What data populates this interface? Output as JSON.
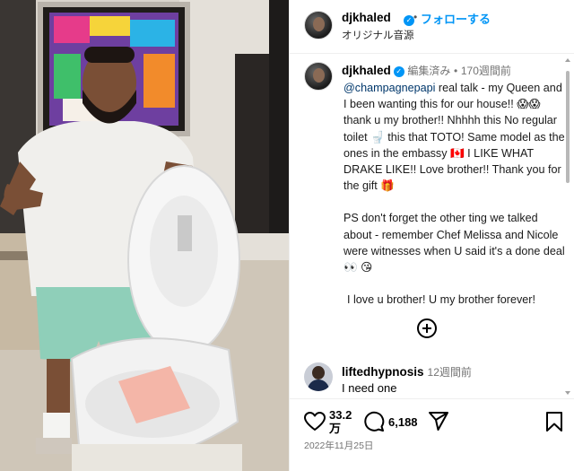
{
  "post": {
    "username": "djkhaled",
    "follow_label": "フォローする",
    "audio": "オリジナル音源",
    "separator": "•"
  },
  "caption": {
    "username": "djkhaled",
    "edited": "編集済み",
    "time": "170週間前",
    "mention": "@champagnepapi",
    "line1_rest": " real talk - my Queen and I been wanting this for our house!! 😱😱 thank u my brother!! Nhhhh this No regular toilet 🚽 this that TOTO! Same model as the ones in the embassy 🇨🇦 I LIKE WHAT DRAKE LIKE!! Love brother!! Thank you for the gift 🎁",
    "para2": "PS don't forget the other ting we talked about - remember Chef Melissa and Nicole were witnesses when U said it's a done deal 👀 😘",
    "para3": "I love u brother! U my brother forever!"
  },
  "comment": {
    "username": "liftedhypnosis",
    "time": "12週間前",
    "text": "I need one"
  },
  "stats": {
    "likes_line1": "33.2",
    "likes_line2": "万",
    "comments": "6,188",
    "date": "2022年11月25日"
  },
  "colors": {
    "accent": "#0095f6",
    "mention": "#00376b",
    "muted": "#737373"
  },
  "icons": [
    "verified-icon",
    "heart-icon",
    "comment-icon",
    "share-icon",
    "bookmark-icon",
    "plus-circle-icon"
  ]
}
